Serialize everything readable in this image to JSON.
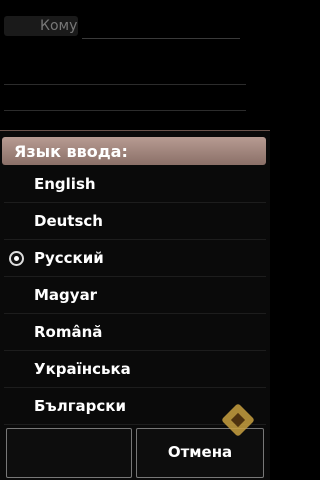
{
  "compose": {
    "to_label": "Кому"
  },
  "dialog": {
    "title": "Язык ввода:",
    "selected": "Русский",
    "items": [
      {
        "label": "English"
      },
      {
        "label": "Deutsch"
      },
      {
        "label": "Русский"
      },
      {
        "label": "Magyar"
      },
      {
        "label": "Română"
      },
      {
        "label": "Українська"
      },
      {
        "label": "Български"
      }
    ]
  },
  "softkeys": {
    "left_label": "",
    "right_label": "Отмена"
  },
  "colors": {
    "header_accent": "#9c7f76",
    "background": "#000000"
  }
}
